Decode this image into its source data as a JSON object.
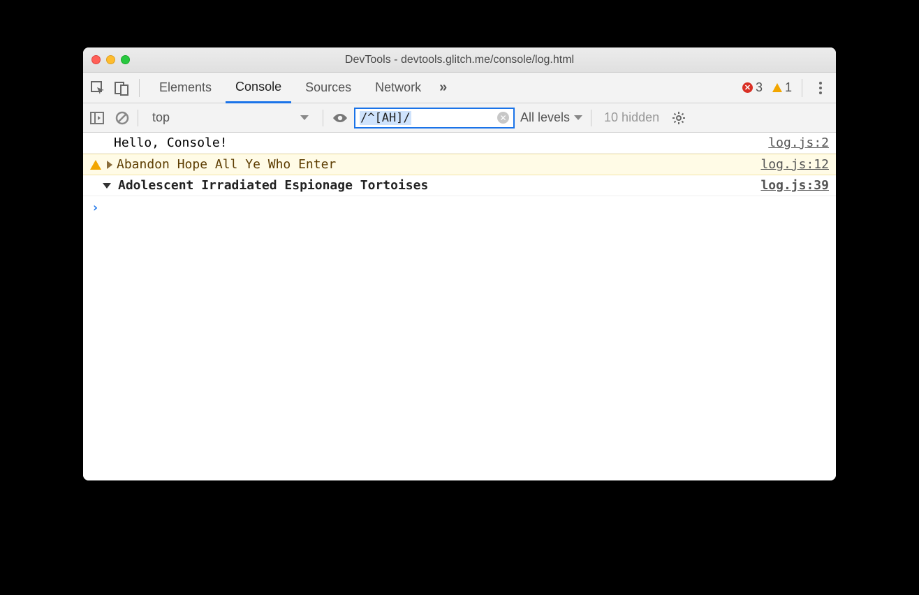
{
  "window": {
    "title": "DevTools - devtools.glitch.me/console/log.html"
  },
  "tabs": {
    "elements": "Elements",
    "console": "Console",
    "sources": "Sources",
    "network": "Network"
  },
  "status": {
    "errors": "3",
    "warnings": "1"
  },
  "toolbar": {
    "context": "top",
    "filter_value": "/^[AH]/",
    "levels_label": "All levels",
    "hidden_label": "10 hidden"
  },
  "logs": [
    {
      "text": "Hello, Console!",
      "source": "log.js:2"
    },
    {
      "text": "Abandon Hope All Ye Who Enter",
      "source": "log.js:12"
    },
    {
      "text": "Adolescent Irradiated Espionage Tortoises",
      "source": "log.js:39"
    }
  ]
}
